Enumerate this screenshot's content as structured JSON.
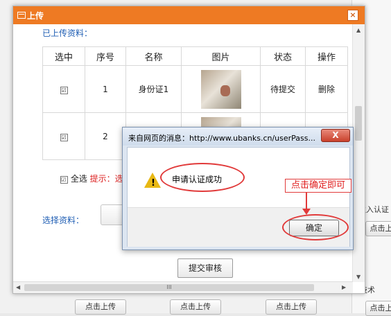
{
  "background": {
    "right_texts": {
      "upper": "秋入认证",
      "lower": "技术"
    },
    "buttons": {
      "right1": "点击上",
      "right2": "点击上",
      "bottom1": "点击上传",
      "bottom2": "点击上传",
      "bottom3": "点击上传"
    }
  },
  "dialog": {
    "title": "上传",
    "close_icon": "×",
    "uploaded_label": "已上传资料：",
    "table": {
      "headers": [
        "选中",
        "序号",
        "名称",
        "图片",
        "状态",
        "操作"
      ],
      "rows": [
        {
          "checked": "☑",
          "index": "1",
          "name": "身份证1",
          "status": "待提交",
          "action": "删除"
        },
        {
          "checked": "☑",
          "index": "2",
          "name": "",
          "status": "",
          "action": ""
        }
      ]
    },
    "select_all": {
      "label": "全选",
      "tip": "提示：选"
    },
    "choose_label": "选择资料：",
    "submit_button": "提交审核",
    "hscroll_grip": "III"
  },
  "alert": {
    "title": "来自网页的消息：http://www.ubanks.cn/userPass...",
    "close": "X",
    "icon": "warning-icon",
    "message": "申请认证成功",
    "ok_button": "确定"
  },
  "annotation": {
    "text": "点击确定即可"
  },
  "colors": {
    "title_bar": "#ee7a23",
    "link_blue": "#1f5eb4",
    "annotation_red": "#e13a3a"
  }
}
